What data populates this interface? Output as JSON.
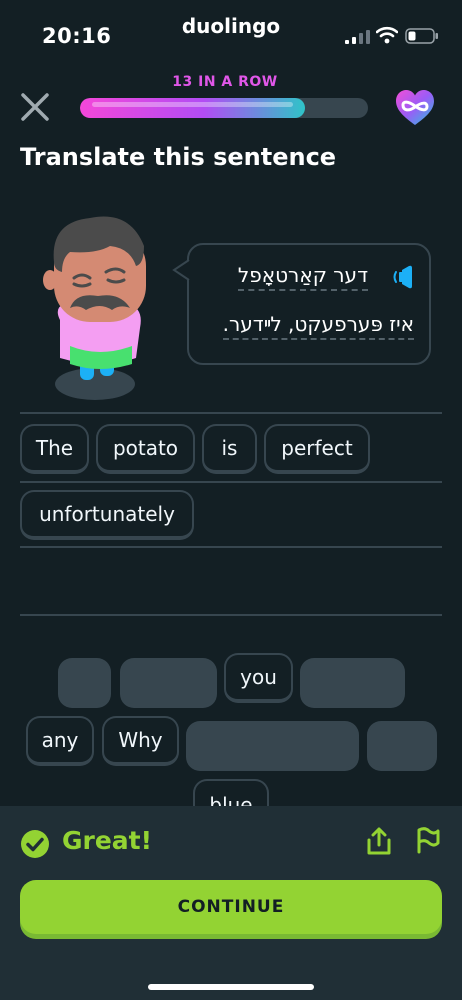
{
  "status_bar": {
    "time": "20:16",
    "app_name": "duolingo"
  },
  "header": {
    "streak_label": "13 IN A ROW",
    "progress": 0.78
  },
  "prompt": {
    "title": "Translate this sentence"
  },
  "sentence": {
    "line1": "דער קאַרטאָפל",
    "line2": "איז פּערפעקט, לײדער."
  },
  "answer_words": [
    "The",
    "potato",
    "is",
    "perfect",
    "unfortunately"
  ],
  "bank_words": {
    "you": "you",
    "any": "any",
    "why": "Why",
    "blue": "blue"
  },
  "feedback": {
    "message": "Great!",
    "continue_label": "CONTINUE"
  },
  "colors": {
    "background": "#131f24",
    "accent_green": "#93d333",
    "streak_pink": "#e057e8",
    "border": "#37464f"
  },
  "icons": [
    "close-icon",
    "heart-infinity-icon",
    "speaker-icon",
    "check-circle-icon",
    "share-icon",
    "flag-icon"
  ]
}
